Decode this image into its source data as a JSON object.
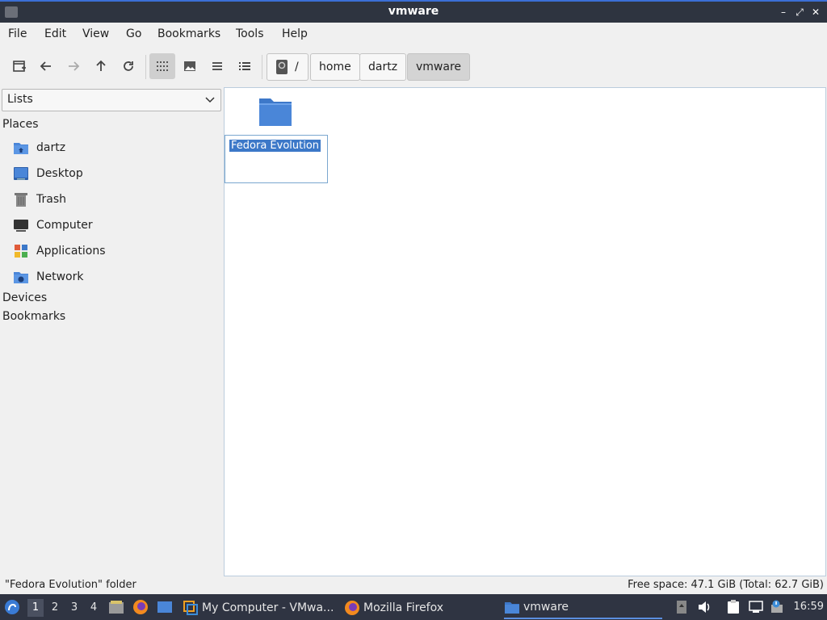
{
  "window": {
    "title": "vmware"
  },
  "menu": [
    "File",
    "Edit",
    "View",
    "Go",
    "Bookmarks",
    "Tools",
    "Help"
  ],
  "breadcrumb": [
    "/",
    "home",
    "dartz",
    "vmware"
  ],
  "sidebar": {
    "combo_value": "Lists",
    "places_header": "Places",
    "places": [
      {
        "label": "dartz",
        "icon": "home-folder-icon"
      },
      {
        "label": "Desktop",
        "icon": "desktop-icon"
      },
      {
        "label": "Trash",
        "icon": "trash-icon"
      },
      {
        "label": "Computer",
        "icon": "computer-icon"
      },
      {
        "label": "Applications",
        "icon": "applications-icon"
      },
      {
        "label": "Network",
        "icon": "network-icon"
      }
    ],
    "devices_header": "Devices",
    "bookmarks_header": "Bookmarks"
  },
  "files": [
    {
      "name": "Fedora Evolution",
      "type": "folder"
    }
  ],
  "status": {
    "left": "\"Fedora Evolution\" folder",
    "right": "Free space: 47.1 GiB (Total: 62.7 GiB)"
  },
  "taskbar": {
    "workspaces": [
      "1",
      "2",
      "3",
      "4"
    ],
    "active_workspace": "1",
    "tasks": [
      {
        "label": "My Computer - VMwa...",
        "icon": "vmware-icon"
      },
      {
        "label": "Mozilla Firefox",
        "icon": "firefox-icon"
      },
      {
        "label": "vmware",
        "icon": "folder-icon"
      }
    ],
    "clock": "16:59"
  },
  "colors": {
    "accent": "#3c78c8",
    "taskbar": "#2f3442",
    "titlebar": "#2e3440",
    "folder": "#4a86d8"
  }
}
